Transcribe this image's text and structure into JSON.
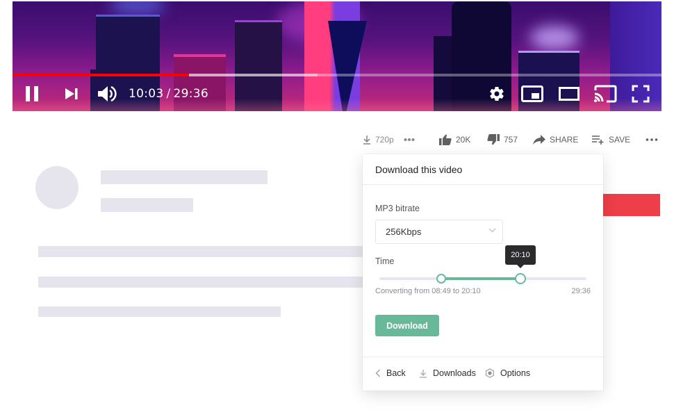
{
  "player": {
    "progress": {
      "current": "10:03",
      "duration": "29:36",
      "played_fraction": 0.2717,
      "buffered_fraction": 0.47
    },
    "time_separator": "/",
    "controls": [
      {
        "name": "pause-button",
        "icon": "pause-icon"
      },
      {
        "name": "next-button",
        "icon": "skip-next-icon"
      },
      {
        "name": "volume-button",
        "icon": "volume-icon"
      },
      {
        "name": "settings-button",
        "icon": "gear-icon"
      },
      {
        "name": "miniplayer-button",
        "icon": "miniplayer-icon"
      },
      {
        "name": "theater-button",
        "icon": "theater-mode-icon"
      },
      {
        "name": "cast-button",
        "icon": "cast-icon"
      },
      {
        "name": "fullscreen-button",
        "icon": "fullscreen-icon"
      }
    ],
    "colors": {
      "played": "#ff0000"
    }
  },
  "actions": {
    "quality": {
      "icon": "download-icon",
      "label": "720p"
    },
    "quality_more": {
      "icon": "more-dots-icon"
    },
    "like": {
      "icon": "thumbs-up-icon",
      "label": "20K"
    },
    "dislike": {
      "icon": "thumbs-down-icon",
      "label": "757"
    },
    "share": {
      "icon": "share-arrow-icon",
      "label": "SHARE"
    },
    "save": {
      "icon": "playlist-add-icon",
      "label": "SAVE"
    },
    "more": {
      "icon": "more-dots-icon"
    }
  },
  "popup": {
    "title": "Download this video",
    "bitrate_label": "MP3 bitrate",
    "bitrate_value": "256Kbps",
    "time_label": "Time",
    "time_range": {
      "start": "08:49",
      "end": "20:10",
      "total": "29:36",
      "start_fraction": 0.2979,
      "end_fraction": 0.6813
    },
    "tooltip": "20:10",
    "converting_text": "Converting from 08:49 to 20:10",
    "total_time": "29:36",
    "download_button": "Download",
    "footer": {
      "back": {
        "icon": "chevron-left-icon",
        "label": "Back"
      },
      "downloads": {
        "icon": "download-icon",
        "label": "Downloads"
      },
      "options": {
        "icon": "gear-icon",
        "label": "Options"
      }
    },
    "colors": {
      "accent": "#67b99a"
    }
  },
  "accent_block_color": "#ee3e4a"
}
